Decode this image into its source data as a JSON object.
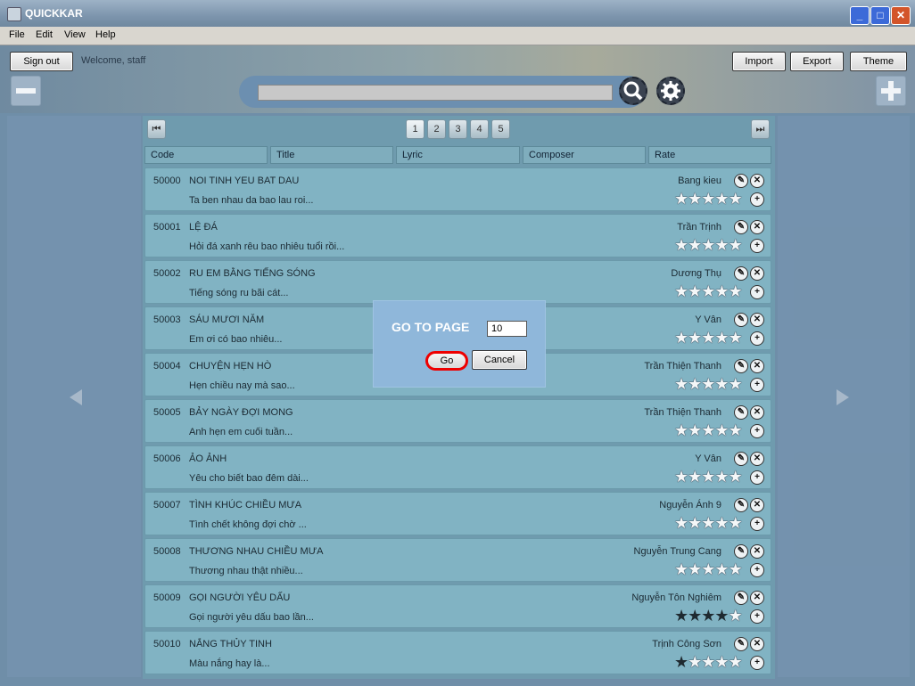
{
  "window": {
    "title": "QUICKKAR",
    "min": "_",
    "max": "□",
    "close": "✕"
  },
  "menu": [
    "File",
    "Edit",
    "View",
    "Help"
  ],
  "toolbar": {
    "sign_out": "Sign out",
    "welcome": "Welcome, staff",
    "import": "Import",
    "export": "Export",
    "theme": "Theme",
    "search_value": ""
  },
  "pagination": {
    "first": "⏮",
    "last": "⏭",
    "pages": [
      "1",
      "2",
      "3",
      "4",
      "5"
    ],
    "current": "1"
  },
  "columns": [
    "Code",
    "Title",
    "Lyric",
    "Composer",
    "Rate"
  ],
  "rows": [
    {
      "code": "50000",
      "title": "NOI TINH YEU BAT DAU",
      "lyric": "Ta ben nhau da bao lau roi...",
      "composer": "Bang kieu",
      "rating": 0
    },
    {
      "code": "50001",
      "title": "LỆ ĐÁ",
      "lyric": "Hỏi đá xanh rêu bao nhiêu tuổi rồi...",
      "composer": "Trần Trịnh",
      "rating": 0
    },
    {
      "code": "50002",
      "title": "RU EM BẰNG TIẾNG SÓNG",
      "lyric": "Tiếng sóng ru bãi cát...",
      "composer": "Dương Thụ",
      "rating": 0
    },
    {
      "code": "50003",
      "title": "SÁU MƯƠI NĂM",
      "lyric": "Em ơi có bao nhiêu...",
      "composer": "Y Vân",
      "rating": 0
    },
    {
      "code": "50004",
      "title": "CHUYỆN HẸN HÒ",
      "lyric": "Hẹn chiều nay mà sao...",
      "composer": "Trần Thiện Thanh",
      "rating": 0
    },
    {
      "code": "50005",
      "title": "BẢY NGÀY ĐỢI MONG",
      "lyric": "Anh hẹn em cuối tuần...",
      "composer": "Trần Thiện Thanh",
      "rating": 0
    },
    {
      "code": "50006",
      "title": "ẢO ẢNH",
      "lyric": "Yêu cho biết bao đêm dài...",
      "composer": "Y Vân",
      "rating": 0
    },
    {
      "code": "50007",
      "title": "TÌNH KHÚC CHIỀU MƯA",
      "lyric": "Tình chết không đợi chờ ...",
      "composer": "Nguyễn Ánh 9",
      "rating": 0
    },
    {
      "code": "50008",
      "title": "THƯƠNG NHAU CHIỀU MƯA",
      "lyric": "Thương nhau thật nhiều...",
      "composer": "Nguyễn Trung Cang",
      "rating": 0
    },
    {
      "code": "50009",
      "title": "GỌI NGƯỜI YÊU DẤU",
      "lyric": "Gọi người yêu dấu bao lần...",
      "composer": "Nguyễn Tôn Nghiêm",
      "rating": 4
    },
    {
      "code": "50010",
      "title": "NẮNG THỦY TINH",
      "lyric": "Màu nắng hay là...",
      "composer": "Trịnh Công Sơn",
      "rating": 1
    }
  ],
  "dialog": {
    "title": "GO TO PAGE",
    "page_value": "10",
    "go": "Go",
    "cancel": "Cancel"
  }
}
